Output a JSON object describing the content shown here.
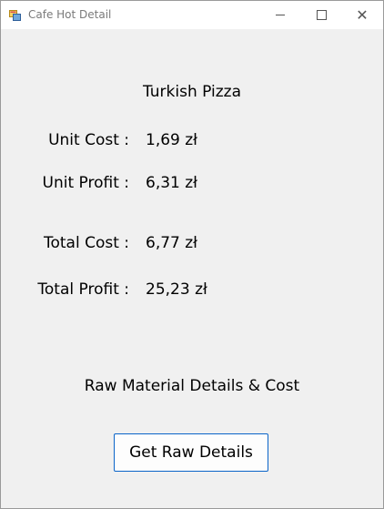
{
  "window": {
    "title": "Cafe Hot Detail",
    "app_icon": "window-app-icon",
    "controls": {
      "minimize_icon": "minimize-icon",
      "maximize_icon": "maximize-icon",
      "close_icon": "close-icon",
      "close_glyph": "✕"
    }
  },
  "product": {
    "name": "Turkish Pizza"
  },
  "costs": {
    "unit_cost_label": "Unit Cost :",
    "unit_cost_value": "1,69 zł",
    "unit_profit_label": "Unit Profit :",
    "unit_profit_value": "6,31 zł",
    "total_cost_label": "Total Cost :",
    "total_cost_value": "6,77 zł",
    "total_profit_label": "Total Profit :",
    "total_profit_value": "25,23 zł"
  },
  "raw_section": {
    "heading": "Raw Material Details & Cost",
    "button_label": "Get Raw Details"
  },
  "colors": {
    "window_bg": "#f0f0f0",
    "button_border": "#0a64c8"
  }
}
